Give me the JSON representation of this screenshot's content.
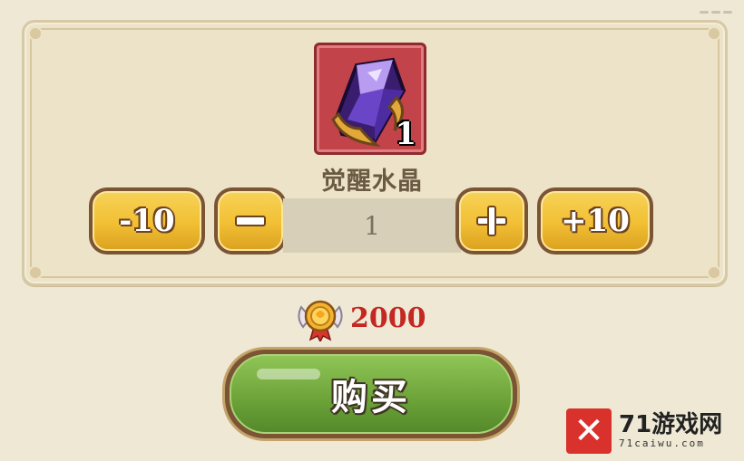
{
  "item": {
    "name": "觉醒水晶",
    "count": "1",
    "icon": "purple-crystal-icon"
  },
  "quantity": {
    "minus10_label": "-10",
    "minus_icon": "minus-icon",
    "plus_icon": "plus-icon",
    "plus10_label": "+10",
    "value": "1"
  },
  "price": {
    "currency_icon": "winged-medal-icon",
    "amount": "2000"
  },
  "buy_button": {
    "label": "购买"
  },
  "watermark": {
    "logo_glyph": "✕",
    "title": "71游戏网",
    "subtitle": "71caiwu.com"
  },
  "colors": {
    "accent_gold": "#f1bf34",
    "buy_green": "#6ea43a",
    "price_red": "#c42823",
    "item_frame_red": "#c2434a"
  }
}
